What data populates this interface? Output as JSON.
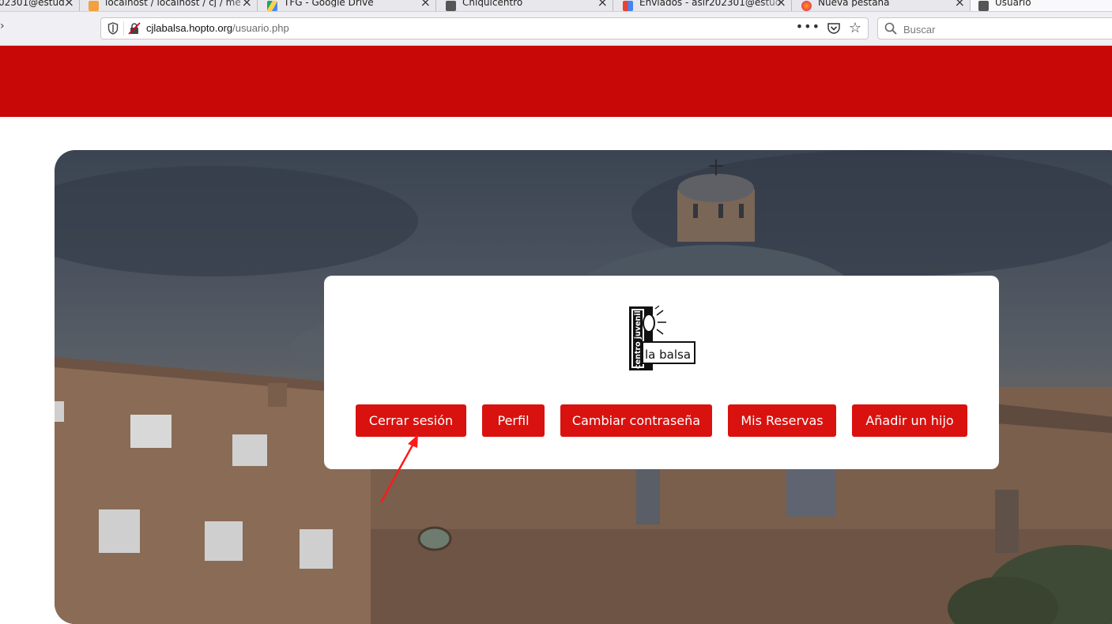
{
  "browser": {
    "tabs": [
      {
        "title": "02301@estud",
        "favicon": "gmail-icon",
        "active": false
      },
      {
        "title": "localhost / localhost / cj / me",
        "favicon": "phpmyadmin-icon",
        "active": false
      },
      {
        "title": "TFG - Google Drive",
        "favicon": "google-drive-icon",
        "active": false
      },
      {
        "title": "Chiquicentro",
        "favicon": "site-icon",
        "active": false
      },
      {
        "title": "Enviados - asir202301@estud",
        "favicon": "gmail-icon",
        "active": false
      },
      {
        "title": "Nueva pestaña",
        "favicon": "firefox-icon",
        "active": false
      },
      {
        "title": "Usuario",
        "favicon": "site-icon",
        "active": true
      }
    ],
    "url": {
      "domain": "cjlabalsa.hopto.org",
      "path": "/usuario.php"
    },
    "search": {
      "placeholder": "Buscar"
    }
  },
  "colors": {
    "header_red": "#c80707",
    "button_red": "#d9120f",
    "annotation_arrow": "#ff1a1a"
  },
  "card": {
    "logo": {
      "vertical_text": "centro juvenil",
      "name": "la balsa"
    },
    "buttons": {
      "logout": "Cerrar sesión",
      "profile": "Perfil",
      "change_password": "Cambiar contraseña",
      "reservations": "Mis Reservas",
      "add_child": "Añadir un hijo"
    }
  }
}
